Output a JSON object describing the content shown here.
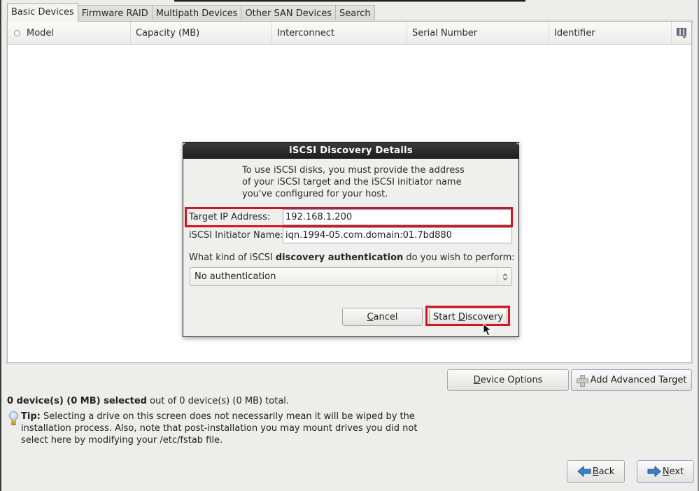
{
  "tabs": [
    {
      "label": "Basic Devices",
      "active": true
    },
    {
      "label": "Firmware RAID",
      "active": false
    },
    {
      "label": "Multipath Devices",
      "active": false
    },
    {
      "label": "Other SAN Devices",
      "active": false
    },
    {
      "label": "Search",
      "active": false
    }
  ],
  "table": {
    "columns": [
      "Model",
      "Capacity (MB)",
      "Interconnect",
      "Serial Number",
      "Identifier"
    ],
    "rows": []
  },
  "dialog": {
    "title": "iSCSI Discovery Details",
    "intro": "To use iSCSI disks, you must provide the address of your iSCSI target and the iSCSI initiator name you've configured for your host.",
    "target_ip_label": "Target IP Address:",
    "target_ip_value": "192.168.1.200",
    "initiator_label": "iSCSI Initiator Name:",
    "initiator_value": "iqn.1994-05.com.domain:01.7bd880",
    "auth_question_pre": "What kind of iSCSI ",
    "auth_question_bold": "discovery authentication",
    "auth_question_post": " do you wish to perform:",
    "auth_selected": "No authentication",
    "cancel_mnemonic": "C",
    "cancel_rest": "ancel",
    "start_pre": "Start ",
    "start_mnemonic": "D",
    "start_rest": "iscovery"
  },
  "buttons": {
    "device_options_mnemonic": "D",
    "device_options_rest": "evice Options",
    "add_target": "Add Advanced Target",
    "back_mnemonic": "B",
    "back_rest": "ack",
    "next_mnemonic": "N",
    "next_rest": "ext"
  },
  "summary": {
    "bold": "0 device(s) (0 MB) selected",
    "rest": " out of 0 device(s) (0 MB) total."
  },
  "tip": {
    "label": "Tip:",
    "text": " Selecting a drive on this screen does not necessarily mean it will be wiped by the installation process.  Also, note that post-installation you may mount drives you did not select here by modifying your /etc/fstab file."
  },
  "colors": {
    "highlight": "#d4141e",
    "dialog_title_bg": "#1e1e1e",
    "arrow_blue": "#3a7fc8"
  }
}
